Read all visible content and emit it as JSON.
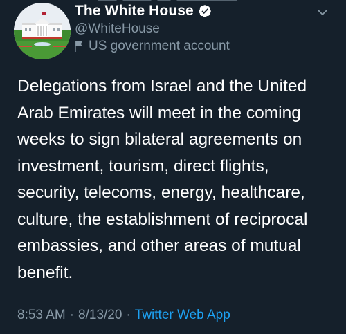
{
  "tweet": {
    "author": {
      "display_name": "The White House",
      "handle": "@WhiteHouse",
      "account_label": "US government account",
      "verified_icon": "verified-badge-icon",
      "label_icon": "flag-icon"
    },
    "text": "Delegations from Israel and the United\nArab Emirates will meet in the coming\nweeks to sign bilateral agreements on\ninvestment, tourism, direct flights,\nsecurity, telecoms, energy, healthcare,\nculture, the establishment of reciprocal\nembassies, and other areas of mutual\nbenefit.",
    "time": "8:53 AM",
    "separator": "·",
    "date": "8/13/20",
    "source": "Twitter Web App",
    "menu_icon": "chevron-down-icon"
  },
  "colors": {
    "background": "#15202b",
    "primary_text": "#ffffff",
    "secondary_text": "#8899a6",
    "link": "#1da1f2"
  }
}
